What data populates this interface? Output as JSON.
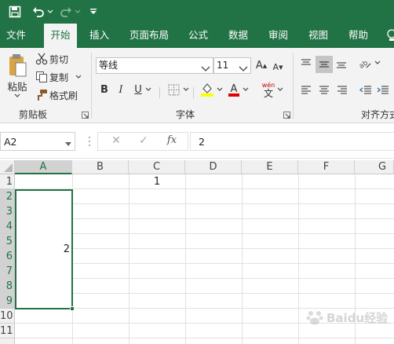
{
  "quick_access": {
    "save_icon": "save-icon",
    "undo_icon": "undo-icon",
    "redo_icon": "redo-icon",
    "customize_icon": "customize-qat-icon"
  },
  "tabs": [
    "文件",
    "开始",
    "插入",
    "页面布局",
    "公式",
    "数据",
    "审阅",
    "视图",
    "帮助"
  ],
  "active_tab": "开始",
  "clipboard": {
    "paste": "粘贴",
    "cut": "剪切",
    "copy": "复制",
    "format_painter": "格式刷",
    "group_label": "剪贴板"
  },
  "font": {
    "name": "等线",
    "size": "11",
    "bold": "B",
    "italic": "I",
    "underline": "U",
    "grow": "A",
    "shrink": "A",
    "phonetic_top": "wén",
    "phonetic_bottom": "文",
    "group_label": "字体"
  },
  "alignment": {
    "group_label": "对齐方式"
  },
  "formula_bar": {
    "name_box": "A2",
    "cancel": "✕",
    "enter": "✓",
    "fx": "fx",
    "value": "2"
  },
  "sheet": {
    "columns": [
      "A",
      "B",
      "C",
      "D",
      "E",
      "F",
      "G"
    ],
    "rows": [
      "1",
      "2",
      "3",
      "4",
      "5",
      "6",
      "7",
      "8",
      "9",
      "10",
      "11"
    ],
    "cells": {
      "C1": "1",
      "A2": "2"
    },
    "selected_range": "A2:A9"
  },
  "watermark": "Baidu经验",
  "colors": {
    "accent": "#217346",
    "selection": "#217346"
  }
}
